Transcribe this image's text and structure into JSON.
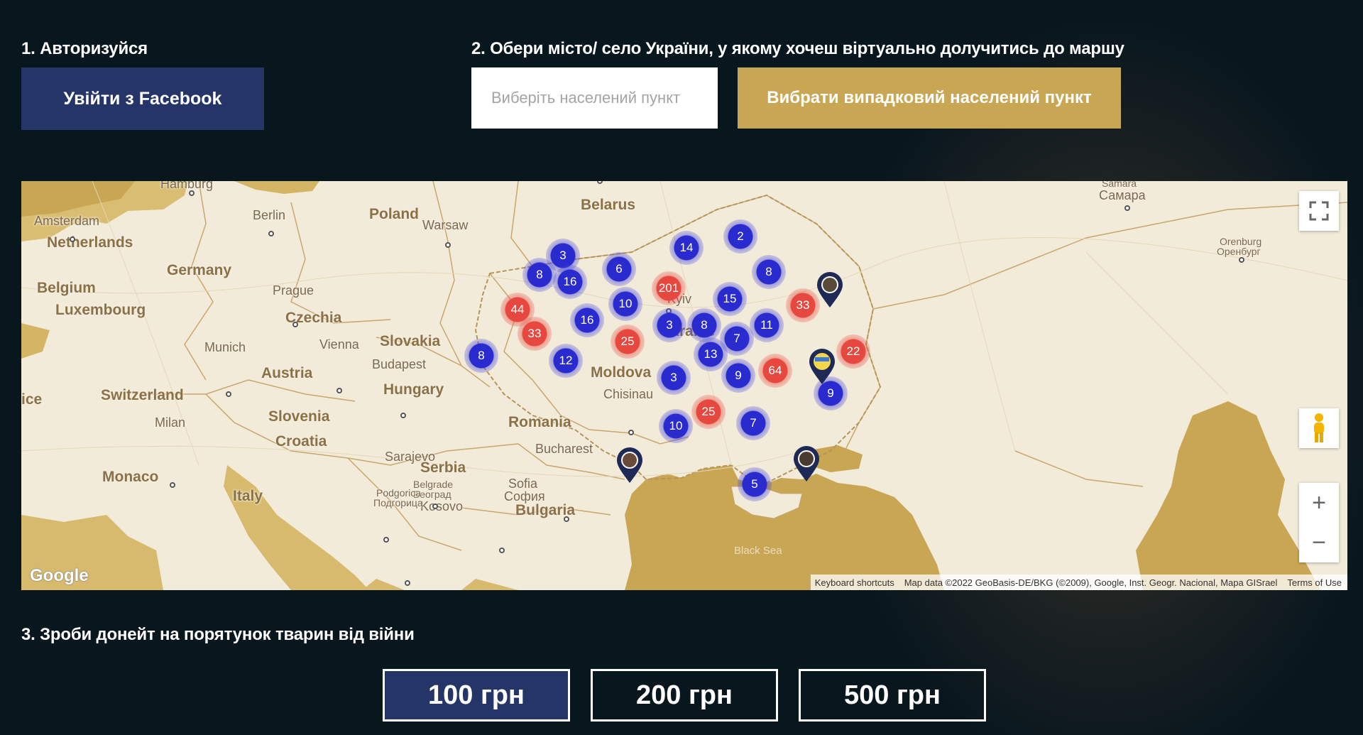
{
  "step1": {
    "title": "1. Авторизуйся",
    "facebook_button": "Увійти з Facebook"
  },
  "step2": {
    "title": "2. Обери місто/ село України, у якому хочеш віртуально долучитись до маршу",
    "placeholder": "Виберіть населений пункт",
    "random_button": "Вибрати випадковий населений пункт"
  },
  "map": {
    "countries": [
      "Belarus",
      "Poland",
      "Germany",
      "Netherlands",
      "Belgium",
      "Luxembourg",
      "Czechia",
      "Slovakia",
      "Austria",
      "Hungary",
      "Switzerland",
      "Slovenia",
      "Croatia",
      "Serbia",
      "Romania",
      "Moldova",
      "Bulgaria",
      "Italy",
      "Monaco",
      "Kosovo",
      "Ukraine",
      "ice"
    ],
    "cities": [
      "Hamburg",
      "Amsterdam",
      "Berlin",
      "Warsaw",
      "Prague",
      "Munich",
      "Vienna",
      "Budapest",
      "Milan",
      "Sarajevo",
      "Belgrade",
      "Београд",
      "Bucharest",
      "Chisinau",
      "Sofia",
      "София",
      "Podgorica",
      "Подгорица",
      "Kyiv",
      "Samara",
      "Самара",
      "Orenburg",
      "Оренбург"
    ],
    "sea": "Black Sea",
    "clusters": [
      {
        "count": "3",
        "color": "blue"
      },
      {
        "count": "8",
        "color": "blue"
      },
      {
        "count": "16",
        "color": "blue"
      },
      {
        "count": "6",
        "color": "blue"
      },
      {
        "count": "14",
        "color": "blue"
      },
      {
        "count": "2",
        "color": "blue"
      },
      {
        "count": "8",
        "color": "blue"
      },
      {
        "count": "201",
        "color": "red"
      },
      {
        "count": "44",
        "color": "red"
      },
      {
        "count": "33",
        "color": "red"
      },
      {
        "count": "16",
        "color": "blue"
      },
      {
        "count": "10",
        "color": "blue"
      },
      {
        "count": "15",
        "color": "blue"
      },
      {
        "count": "33",
        "color": "red"
      },
      {
        "count": "3",
        "color": "blue"
      },
      {
        "count": "8",
        "color": "blue"
      },
      {
        "count": "7",
        "color": "blue"
      },
      {
        "count": "11",
        "color": "blue"
      },
      {
        "count": "25",
        "color": "red"
      },
      {
        "count": "8",
        "color": "blue"
      },
      {
        "count": "12",
        "color": "blue"
      },
      {
        "count": "13",
        "color": "blue"
      },
      {
        "count": "22",
        "color": "red"
      },
      {
        "count": "3",
        "color": "blue"
      },
      {
        "count": "9",
        "color": "blue"
      },
      {
        "count": "64",
        "color": "red"
      },
      {
        "count": "9",
        "color": "blue"
      },
      {
        "count": "25",
        "color": "red"
      },
      {
        "count": "10",
        "color": "blue"
      },
      {
        "count": "7",
        "color": "blue"
      },
      {
        "count": "5",
        "color": "blue"
      }
    ],
    "logo": "Google",
    "attribution": {
      "shortcuts": "Keyboard shortcuts",
      "data": "Map data ©2022 GeoBasis-DE/BKG (©2009), Google, Inst. Geogr. Nacional, Mapa GISrael",
      "terms": "Terms of Use"
    },
    "controls": {
      "zoom_in": "+",
      "zoom_out": "−"
    }
  },
  "step3": {
    "title": "3. Зроби донейт на порятунок тварин від війни"
  },
  "amounts": [
    {
      "label": "100 грн",
      "selected": true
    },
    {
      "label": "200 грн",
      "selected": false
    },
    {
      "label": "500 грн",
      "selected": false
    }
  ],
  "colors": {
    "background": "#08161e",
    "facebook": "#263568",
    "gold": "#c8a654",
    "cluster_blue": "#2a2bcf",
    "cluster_red": "#e6483f"
  }
}
